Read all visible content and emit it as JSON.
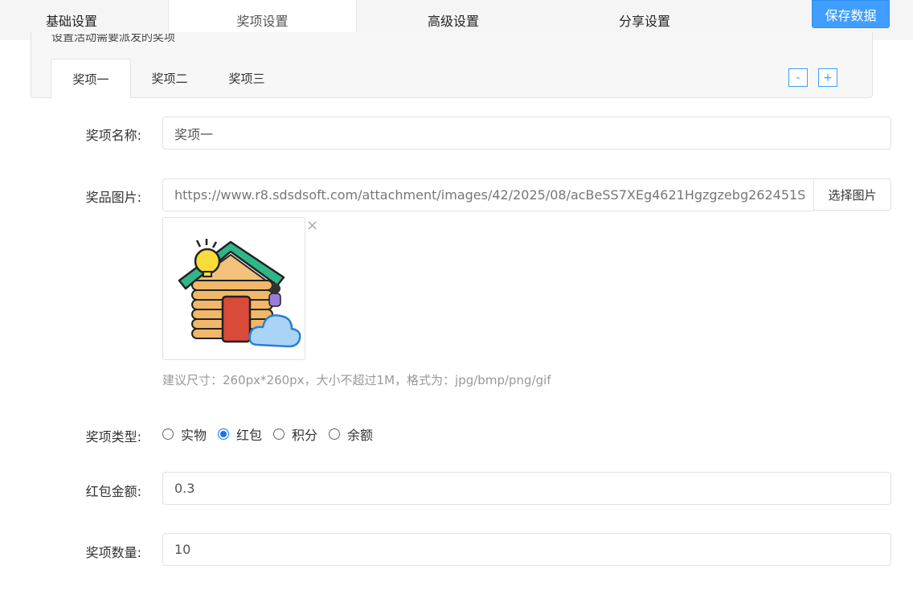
{
  "top_tabs": [
    {
      "label": "基础设置"
    },
    {
      "label": "奖项设置"
    },
    {
      "label": "高级设置"
    },
    {
      "label": "分享设置"
    }
  ],
  "save_label": "保存数据",
  "panel_hint": "设置活动需要派发的奖项",
  "prize_tabs": [
    {
      "label": "奖项一"
    },
    {
      "label": "奖项二"
    },
    {
      "label": "奖项三"
    }
  ],
  "minus_label": "-",
  "plus_label": "+",
  "form": {
    "name_label": "奖项名称:",
    "name_value": "奖项一",
    "image_label": "奖品图片:",
    "image_url": "https://www.r8.sdsdsoft.com/attachment/images/42/2025/08/acBeSS7XEg4621Hgzgzebg262451S",
    "pick_label": "选择图片",
    "remove_glyph": "×",
    "image_hint": "建议尺寸：260px*260px，大小不超过1M，格式为：jpg/bmp/png/gif",
    "type_label": "奖项类型:",
    "type_options": [
      {
        "label": "实物",
        "checked": false
      },
      {
        "label": "红包",
        "checked": true
      },
      {
        "label": "积分",
        "checked": false
      },
      {
        "label": "余额",
        "checked": false
      }
    ],
    "amount_label": "红包金额:",
    "amount_value": "0.3",
    "count_label": "奖项数量:",
    "count_value": "10"
  },
  "colors": {
    "accent": "#3f9eff",
    "radio_checked": "#1a73e8"
  },
  "icons": {
    "prize_image": "house-lightbulb-cloud-illustration"
  }
}
